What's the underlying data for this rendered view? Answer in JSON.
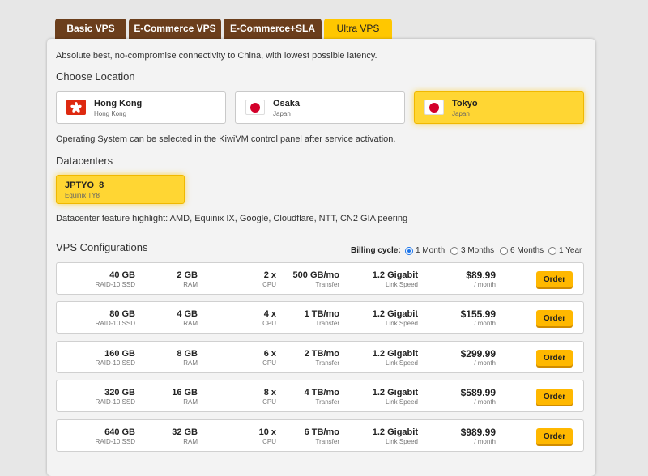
{
  "tabs": [
    {
      "label": "Basic VPS"
    },
    {
      "label": "E-Commerce VPS"
    },
    {
      "label": "E-Commerce+SLA"
    },
    {
      "label": "Ultra VPS"
    }
  ],
  "intro": "Absolute best, no-compromise connectivity to China, with lowest possible latency.",
  "location": {
    "heading": "Choose Location",
    "items": [
      {
        "name": "Hong Kong",
        "sub": "Hong Kong"
      },
      {
        "name": "Osaka",
        "sub": "Japan"
      },
      {
        "name": "Tokyo",
        "sub": "Japan"
      }
    ]
  },
  "os_note": "Operating System can be selected in the KiwiVM control panel after service activation.",
  "datacenters": {
    "heading": "Datacenters",
    "items": [
      {
        "name": "JPTYO_8",
        "sub": "Equinix TY8"
      }
    ]
  },
  "dc_highlight": "Datacenter feature highlight: AMD, Equinix IX, Google, Cloudflare, NTT, CN2 GIA peering",
  "configs": {
    "heading": "VPS Configurations",
    "billing_label": "Billing cycle:",
    "billing_options": [
      "1 Month",
      "3 Months",
      "6 Months",
      "1 Year"
    ],
    "labels": {
      "disk": "RAID-10 SSD",
      "ram": "RAM",
      "cpu": "CPU",
      "transfer": "Transfer",
      "link": "Link Speed",
      "period": "/ month"
    },
    "order_label": "Order",
    "rows": [
      {
        "disk": "40 GB",
        "ram": "2 GB",
        "cpu": "2 x",
        "transfer": "500 GB/mo",
        "link": "1.2 Gigabit",
        "price": "$89.99"
      },
      {
        "disk": "80 GB",
        "ram": "4 GB",
        "cpu": "4 x",
        "transfer": "1 TB/mo",
        "link": "1.2 Gigabit",
        "price": "$155.99"
      },
      {
        "disk": "160 GB",
        "ram": "8 GB",
        "cpu": "6 x",
        "transfer": "2 TB/mo",
        "link": "1.2 Gigabit",
        "price": "$299.99"
      },
      {
        "disk": "320 GB",
        "ram": "16 GB",
        "cpu": "8 x",
        "transfer": "4 TB/mo",
        "link": "1.2 Gigabit",
        "price": "$589.99"
      },
      {
        "disk": "640 GB",
        "ram": "32 GB",
        "cpu": "10 x",
        "transfer": "6 TB/mo",
        "link": "1.2 Gigabit",
        "price": "$989.99"
      }
    ]
  }
}
